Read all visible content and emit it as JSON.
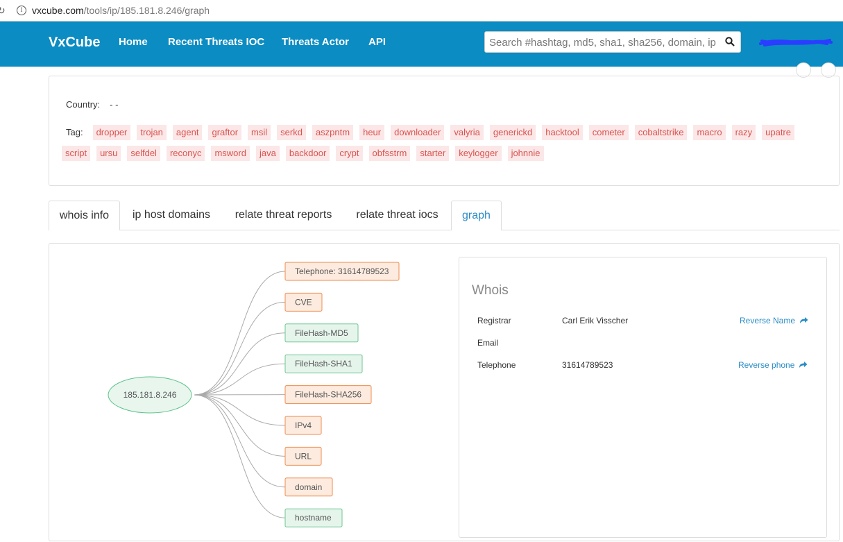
{
  "browser": {
    "url_host": "vxcube.com",
    "url_path": "/tools/ip/185.181.8.246/graph"
  },
  "nav": {
    "brand": "VxCube",
    "links": [
      "Home",
      "Recent Threats IOC",
      "Threats Actor",
      "API"
    ],
    "search_placeholder": "Search #hashtag, md5, sha1, sha256, domain, ip"
  },
  "summary": {
    "country_label": "Country:",
    "country_value": "- -",
    "tag_label": "Tag:",
    "tags": [
      "dropper",
      "trojan",
      "agent",
      "graftor",
      "msil",
      "serkd",
      "aszpntm",
      "heur",
      "downloader",
      "valyria",
      "generickd",
      "hacktool",
      "cometer",
      "cobaltstrike",
      "macro",
      "razy",
      "upatre",
      "script",
      "ursu",
      "selfdel",
      "reconyc",
      "msword",
      "java",
      "backdoor",
      "crypt",
      "obfsstrm",
      "starter",
      "keylogger",
      "johnnie"
    ]
  },
  "tabs": [
    {
      "label": "whois info"
    },
    {
      "label": "ip host domains"
    },
    {
      "label": "relate threat reports"
    },
    {
      "label": "relate threat iocs"
    },
    {
      "label": "graph"
    }
  ],
  "graph": {
    "root": "185.181.8.246",
    "nodes": [
      {
        "label": "Telephone: 31614789523",
        "kind": "orange"
      },
      {
        "label": "CVE",
        "kind": "orange"
      },
      {
        "label": "FileHash-MD5",
        "kind": "green"
      },
      {
        "label": "FileHash-SHA1",
        "kind": "green"
      },
      {
        "label": "FileHash-SHA256",
        "kind": "orange"
      },
      {
        "label": "IPv4",
        "kind": "orange"
      },
      {
        "label": "URL",
        "kind": "orange"
      },
      {
        "label": "domain",
        "kind": "orange"
      },
      {
        "label": "hostname",
        "kind": "green"
      }
    ],
    "colors": {
      "orange_fill": "#fdebdf",
      "orange_stroke": "#ee8b4d",
      "green_fill": "#e6f5ec",
      "green_stroke": "#6cc592",
      "root_fill": "#e8f6ee",
      "root_stroke": "#5cc28a",
      "edge": "#aaaaaa"
    }
  },
  "whois": {
    "title": "Whois",
    "rows": [
      {
        "key": "Registrar",
        "value": "Carl Erik Visscher",
        "action": "Reverse Name"
      },
      {
        "key": "Email",
        "value": "",
        "action": ""
      },
      {
        "key": "Telephone",
        "value": "31614789523",
        "action": "Reverse phone"
      }
    ]
  }
}
